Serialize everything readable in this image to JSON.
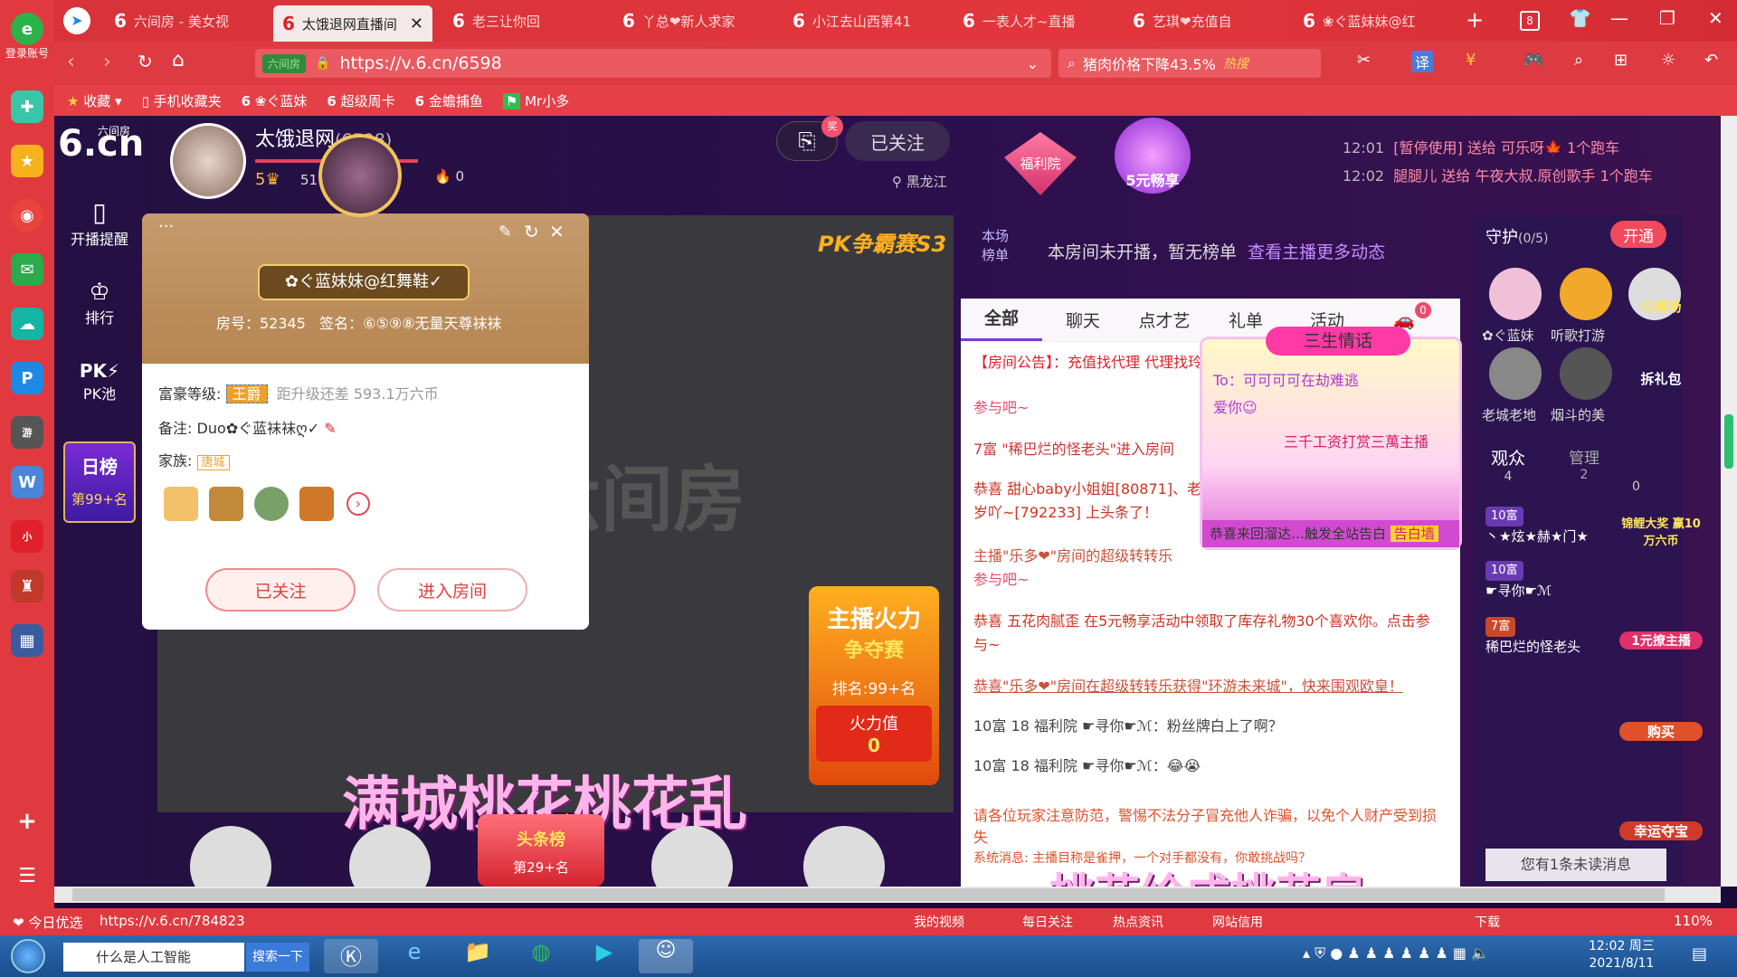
{
  "browser": {
    "tabs": [
      {
        "label": "六间房 - 美女视"
      },
      {
        "label": "太饿退网直播间"
      },
      {
        "label": "老三让你回"
      },
      {
        "label": "丫总❤新人求家"
      },
      {
        "label": "小江去山西第41"
      },
      {
        "label": "一表人才~直播"
      },
      {
        "label": "艺琪❤充值自"
      },
      {
        "label": "❀ぐ蓝妹妹@红"
      }
    ],
    "tab_count": "8",
    "url": "https://v.6.cn/6598",
    "site_badge": "六间房",
    "search_text": "猪肉价格下降43.5%",
    "search_hot": "热搜",
    "login_label": "登录账号",
    "bookmarks": [
      "收藏",
      "手机收藏夹",
      "❀ぐ蓝妹",
      "超级周卡",
      "金蟾捕鱼",
      "Mr小多"
    ],
    "status_left": "今日优选",
    "status_url": "https://v.6.cn/784823",
    "status_items": [
      "我的视频",
      "每日关注",
      "热点资讯",
      "网站信用",
      "下载"
    ],
    "zoom": "110%"
  },
  "site_nav": {
    "logo_small": "六间房",
    "logo": "6.cn",
    "items": [
      {
        "label": "开播提醒"
      },
      {
        "label": "排行"
      },
      {
        "label": "PK池"
      }
    ],
    "daily_rank_title": "日榜",
    "daily_rank_value": "第99+名"
  },
  "anchor": {
    "name": "太饿退网",
    "room_id": "(6598)",
    "level": "5",
    "fans": "5118",
    "fire": "0",
    "location": "黑龙江",
    "follow_label": "已关注",
    "share_badge": "奖",
    "welfare_label": "福利院",
    "five_yuan_label": "5元畅享"
  },
  "ticker": [
    {
      "time": "12:01",
      "text": "[暂停使用] 送给 可乐呀🍁 1个跑车"
    },
    {
      "time": "12:02",
      "text": "腿腿儿 送给 午夜大叔.原创歌手 1个跑车"
    }
  ],
  "video": {
    "pk_badge": "PK争霸赛S3",
    "watermark": "六间房",
    "caption": "满城桃花桃花乱",
    "bottom_caption": "桃花绘成桃花扇",
    "headline_badge": "头条榜",
    "headline_rank": "第29+名",
    "fire_title": "主播火力",
    "fire_subtitle": "争夺赛",
    "fire_rank": "排名:99+名",
    "fire_value_label": "火力值",
    "fire_value": "0"
  },
  "profile_popup": {
    "name": "✿ぐ蓝妹妹@红舞鞋✓",
    "room_label": "房号：52345",
    "sign_label": "签名：⑥⑤⑨⑧无量天尊袜袜",
    "wealth_label": "富豪等级:",
    "wealth_badge": "王爵",
    "upgrade_text": "距升级还差 593.1万六币",
    "note_label": "备注:",
    "note_value": "Duo✿ぐ蓝袜袜ღ✓",
    "family_label": "家族:",
    "family_badge": "唐城",
    "follow_btn": "已关注",
    "enter_btn": "进入房间"
  },
  "ranking": {
    "label": "本场榜单",
    "text": "本房间未开播，暂无榜单",
    "link": "查看主播更多动态"
  },
  "chat": {
    "tabs": [
      "全部",
      "聊天",
      "点才艺",
      "礼单",
      "活动"
    ],
    "car_count": "0",
    "announcement": "【房间公告】：充值找代理 代理找玲姐 金牌 一般",
    "lines": [
      "参与吧~",
      "7富 \"稀巴烂的怪老头\"进入房间",
      "恭喜 甜心baby小姐姐[80871]、老",
      "岁吖~[792233] 上头条了！",
      "主播\"乐多❤\"房间的超级转转乐",
      "参与吧~",
      "恭喜 五花肉腻歪 在5元畅享活动中领取了库存礼物30个喜欢你。点击参",
      "与~",
      "恭喜\"乐多❤\"房间在超级转转乐获得\"环游未来城\"，快来围观欧皇！",
      "10富 18 福利院 ☛寻你☛ℳ：粉丝牌白上了啊？",
      "10富 18 福利院 ☛寻你☛ℳ：😂😭"
    ],
    "warning": "请各位玩家注意防范，警惕不法分子冒充他人诈骗，以免个人财产受到损失",
    "warning2": "系统消息: 主播目称是雀押，一个对手都没有，你敢挑战吗？",
    "gift_popup_title": "三生情话",
    "gift_to": "To：可可可可在劫难逃",
    "gift_msg": "爱你😉",
    "gift_from": "三千工资打赏三萬主播",
    "gift_footer": "恭喜来回溜达…触发全站告白",
    "gift_footer_badge": "告白墙"
  },
  "guard": {
    "title": "守护",
    "count": "(0/5)",
    "open_label": "开通",
    "members": [
      "✿ぐ蓝妹",
      "听歌打游",
      "",
      "老城老地",
      "烟斗的美"
    ],
    "audience_label": "观众",
    "audience_count": "4",
    "admin_label": "管理",
    "admin_count": "2",
    "extra_count": "0",
    "users": [
      {
        "level": "10富",
        "name": "丶★炫★赫★门★"
      },
      {
        "level": "10富",
        "name": "☛寻你☛ℳ"
      },
      {
        "level": "7富",
        "name": "稀巴烂的怪老头"
      }
    ],
    "unread": "您有1条未读消息"
  },
  "side_activities": [
    "斗兽场",
    "拆礼包",
    "锦鲤大奖 赢10万六币",
    "1元撩主播",
    "购买",
    "幸运夺宝"
  ],
  "taskbar": {
    "search_text": "什么是人工智能",
    "search_btn": "搜索一下",
    "time": "12:02 周三",
    "date": "2021/8/11"
  }
}
